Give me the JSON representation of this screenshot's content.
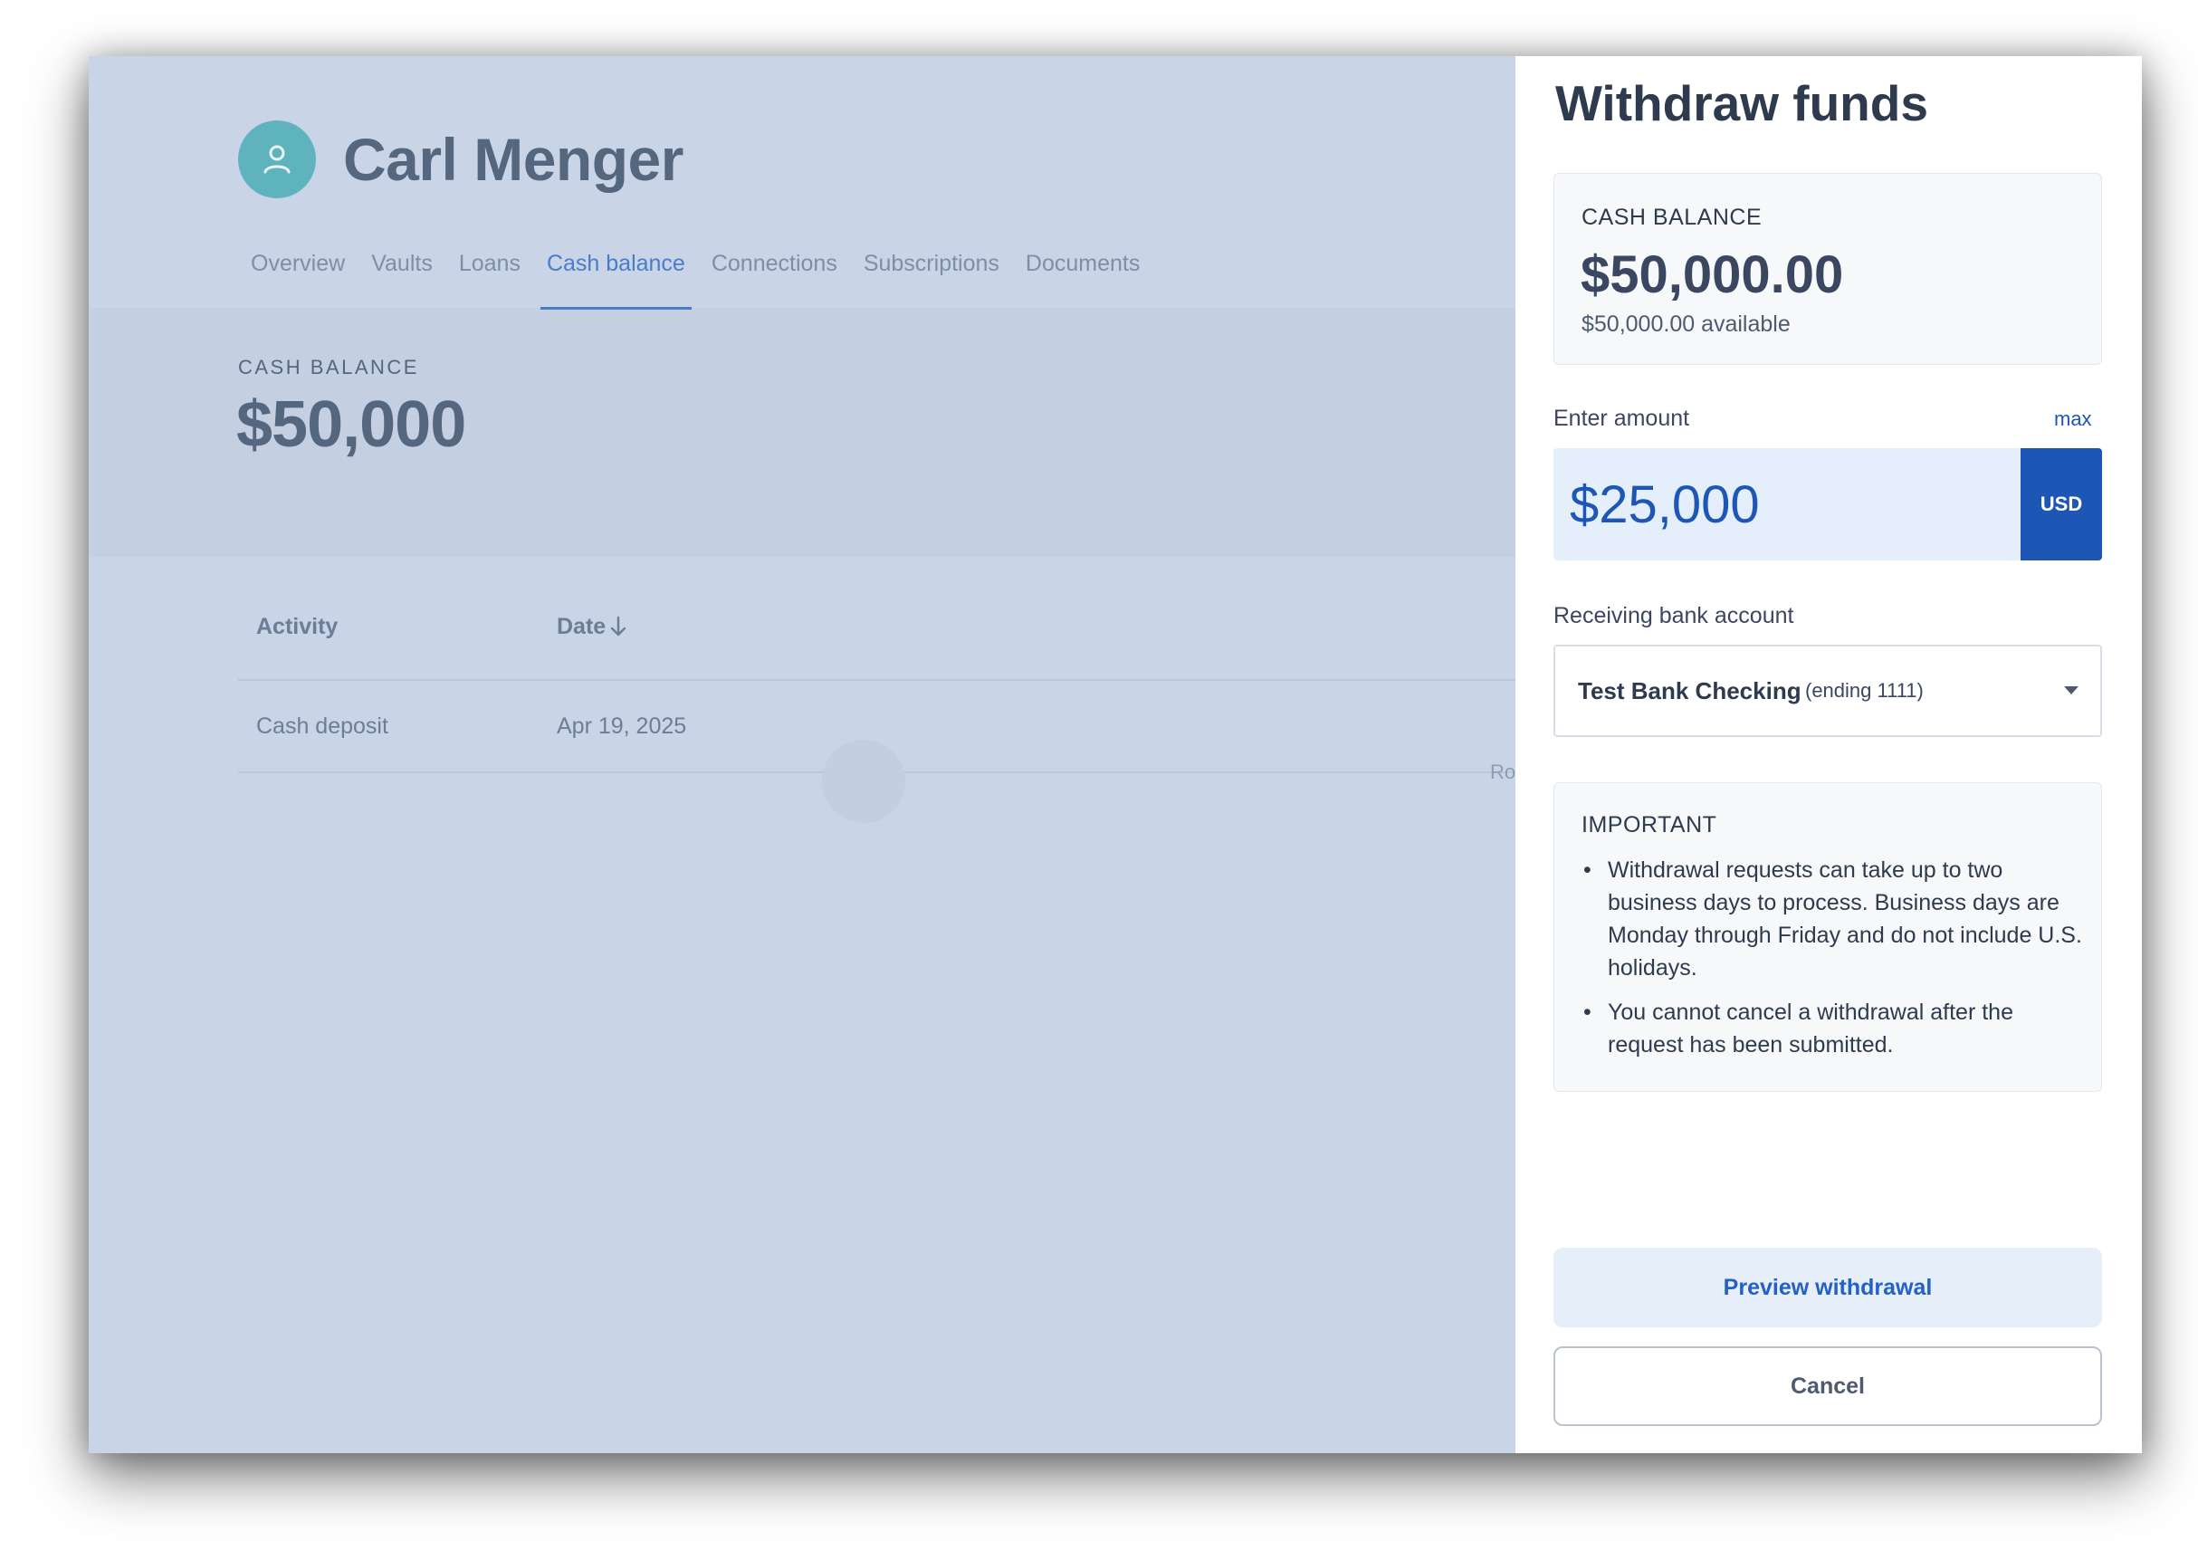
{
  "user": {
    "name": "Carl Menger",
    "avatar_icon": "user-icon"
  },
  "tabs": [
    {
      "label": "Overview",
      "active": false
    },
    {
      "label": "Vaults",
      "active": false
    },
    {
      "label": "Loans",
      "active": false
    },
    {
      "label": "Cash balance",
      "active": true
    },
    {
      "label": "Connections",
      "active": false
    },
    {
      "label": "Subscriptions",
      "active": false
    },
    {
      "label": "Documents",
      "active": false
    }
  ],
  "cash_balance": {
    "label": "CASH BALANCE",
    "value": "$50,000"
  },
  "activity_table": {
    "columns": [
      "Activity",
      "Date"
    ],
    "sort_icon": "arrow-down-icon",
    "rows": [
      {
        "activity": "Cash deposit",
        "date": "Apr 19, 2025"
      }
    ],
    "footer_hint": "Ro"
  },
  "drawer": {
    "title": "Withdraw funds",
    "balance_card": {
      "label": "CASH BALANCE",
      "value": "$50,000.00",
      "available": "$50,000.00 available"
    },
    "amount": {
      "label": "Enter amount",
      "max_label": "max",
      "value": "$25,000",
      "currency": "USD"
    },
    "bank": {
      "label": "Receiving bank account",
      "name": "Test Bank Checking",
      "ending": "(ending 1111)"
    },
    "important": {
      "title": "IMPORTANT",
      "items": [
        "Withdrawal requests can take up to two business days to process. Business days are Monday through Friday and do not include U.S. holidays.",
        "You cannot cancel a withdrawal after the request has been submitted."
      ]
    },
    "preview_label": "Preview withdrawal",
    "cancel_label": "Cancel"
  },
  "colors": {
    "overlay": "#c9d4e6",
    "accent": "#1e56b5",
    "avatar": "#5fb3bd",
    "text_dark": "#2e3a4d"
  }
}
